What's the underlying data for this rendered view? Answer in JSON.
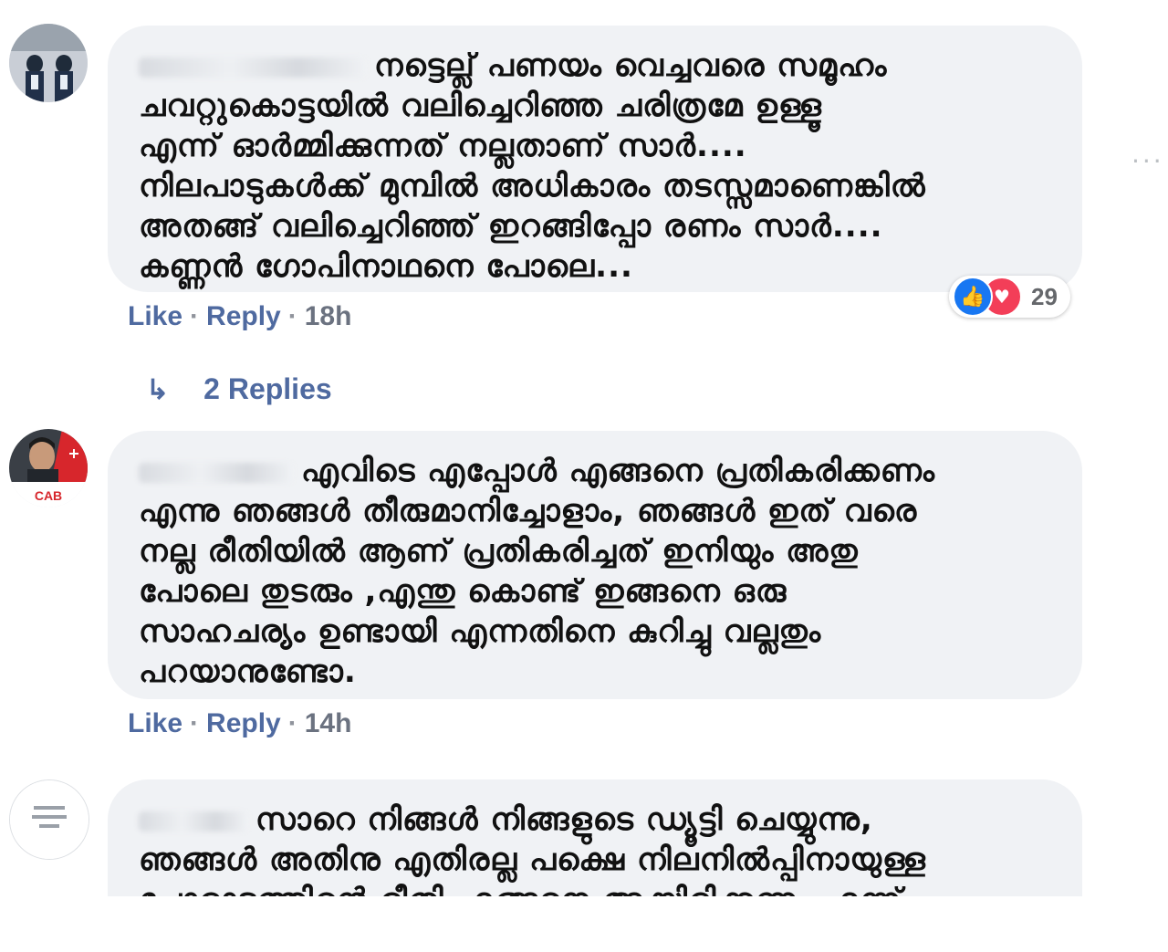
{
  "comments": [
    {
      "text_lines": [
        "നട്ടെല്ല് പണയം വെച്ചവരെ സമൂഹം",
        "ചവറ്റുകൊട്ടയിൽ വലിച്ചെറിഞ്ഞ ചരിത്രമേ ഉള്ളൂ",
        "എന്ന് ഓർമ്മിക്കുന്നത് നല്ലതാണ് സാർ....",
        "നിലപാടുകൾക്ക് മുമ്പിൽ അധികാരം തടസ്സമാണെങ്കിൽ",
        "അതങ്ങ് വലിച്ചെറിഞ്ഞ് ഇറങ്ങിപ്പോ രണം സാർ....",
        "കണ്ണൻ ഗോപിനാഥനെ പോലെ..."
      ],
      "like": "Like",
      "reply": "Reply",
      "time": "18h",
      "reaction_count": "29",
      "more": "···"
    },
    {
      "text_lines": [
        "എവിടെ എപ്പോൾ എങ്ങനെ പ്രതികരിക്കണം",
        "എന്നു ഞങ്ങൾ തീരുമാനിച്ചോളാം, ഞങ്ങൾ ഇത് വരെ",
        "നല്ല രീതിയിൽ ആണ് പ്രതികരിച്ചത് ഇനിയും അതു",
        "പോലെ തുടരും ,എന്തു കൊണ്ട് ഇങ്ങനെ ഒരു",
        "സാഹചര്യം ഉണ്ടായി എന്നതിനെ കുറിച്ചു വല്ലതും",
        "പറയാനുണ്ടോ."
      ],
      "like": "Like",
      "reply": "Reply",
      "time": "14h",
      "avatar_label": "CAB"
    },
    {
      "text_lines": [
        "സാറെ നിങ്ങൾ നിങ്ങളുടെ ഡ്യൂട്ടി ചെയ്യുന്നു,",
        "ഞങ്ങൾ അതിനു എതിരല്ല പക്ഷെ നിലനിൽപ്പിനായുള്ള",
        "പോരാട്ടത്തിന്റെ രീതി എങ്ങനെ ആയിരിക്കണം എന്ന്"
      ]
    }
  ],
  "replies_link": {
    "arrow": "↳",
    "label": "2 Replies"
  },
  "colors": {
    "bubble": "#f0f2f5",
    "link": "#4f6aa0",
    "like": "#1877f2",
    "love": "#f33e58"
  }
}
